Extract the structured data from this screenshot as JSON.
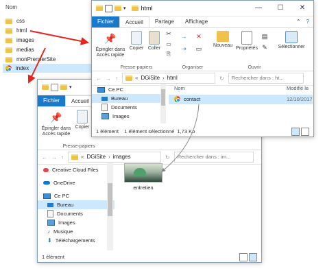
{
  "bg_list": {
    "header": "Nom",
    "items": [
      {
        "label": "css",
        "icon": "folder-icon"
      },
      {
        "label": "html",
        "icon": "folder-icon"
      },
      {
        "label": "images",
        "icon": "folder-icon"
      },
      {
        "label": "medias",
        "icon": "folder-icon"
      },
      {
        "label": "monPremierSite",
        "icon": "folder-icon"
      },
      {
        "label": "index",
        "icon": "chrome-icon"
      }
    ]
  },
  "win_html": {
    "title": "html",
    "tabs": [
      "Fichier",
      "Accueil",
      "Partage",
      "Affichage"
    ],
    "ribbon": {
      "pin": "Épingler dans Accès rapide",
      "copy": "Copier",
      "paste": "Coller",
      "clipboard_group": "Presse-papiers",
      "organise_group": "Organiser",
      "new_folder": "Nouveau",
      "properties": "Propriétés",
      "open_group": "Ouvrir",
      "select": "Sélectionner"
    },
    "address": {
      "path": [
        "DGiSite",
        "html"
      ],
      "search_placeholder": "Rechercher dans : ht..."
    },
    "columns": [
      "Nom",
      "Modifié le"
    ],
    "files": [
      {
        "name": "contact",
        "modified": "12/10/2017",
        "icon": "chrome-icon"
      }
    ],
    "status": "1 élément    1 élément sélectionné  1,73 Ko"
  },
  "win_images": {
    "tabs": [
      "Fichier",
      "Accueil"
    ],
    "ribbon": {
      "pin": "Épingler dans Accès rapide",
      "copy": "Copier",
      "clipboard_group": "Presse-papiers"
    },
    "address": {
      "path": [
        "DGiSite",
        "images"
      ],
      "search_placeholder": "Rechercher dans : im..."
    },
    "nav": [
      {
        "label": "Ce PC",
        "icon": "pc-icon"
      },
      {
        "label": "Bureau",
        "icon": "desktop-icon"
      },
      {
        "label": "Documents",
        "icon": "documents-icon"
      },
      {
        "label": "Images",
        "icon": "images-icon"
      }
    ],
    "nav_full": [
      {
        "label": "Creative Cloud Files",
        "icon": "creative-cloud-icon"
      },
      {
        "label": "OneDrive",
        "icon": "onedrive-icon"
      },
      {
        "label": "Ce PC",
        "icon": "pc-icon"
      },
      {
        "label": "Bureau",
        "icon": "desktop-icon"
      },
      {
        "label": "Documents",
        "icon": "documents-icon"
      },
      {
        "label": "Images",
        "icon": "images-icon"
      },
      {
        "label": "Musique",
        "icon": "music-icon"
      },
      {
        "label": "Téléchargements",
        "icon": "downloads-icon"
      }
    ],
    "thumb_label": "entretien",
    "status": "1 élément"
  },
  "colors": {
    "accent": "#1979ca",
    "selection": "#cce8ff",
    "arrow": "#e8231d"
  }
}
